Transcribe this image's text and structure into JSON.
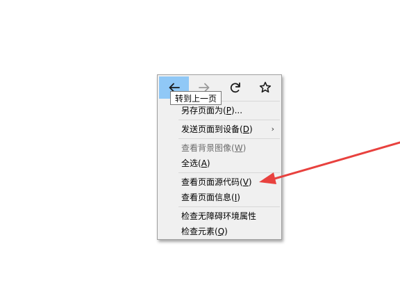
{
  "context_menu": {
    "nav": {
      "back_icon": "arrow-left-icon",
      "forward_icon": "arrow-right-icon",
      "reload_icon": "reload-icon",
      "bookmark_icon": "star-icon"
    },
    "tooltip": "转到上一页",
    "items": [
      {
        "label": "另存页面为(",
        "key": "P",
        "suffix": ")..."
      },
      {
        "label": "发送页面到设备(",
        "key": "D",
        "suffix": ")"
      },
      {
        "label": "查看背景图像(",
        "key": "W",
        "suffix": ")"
      },
      {
        "label": "全选(",
        "key": "A",
        "suffix": ")"
      },
      {
        "label": "查看页面源代码(",
        "key": "V",
        "suffix": ")"
      },
      {
        "label": "查看页面信息(",
        "key": "I",
        "suffix": ")"
      },
      {
        "label": "检查无障碍环境属性",
        "key": "",
        "suffix": ""
      },
      {
        "label": "检查元素(",
        "key": "Q",
        "suffix": ")"
      }
    ],
    "submenu_arrow": "›"
  },
  "colors": {
    "menu_bg": "#f0f0f0",
    "active_nav": "#90c8f6",
    "disabled_text": "#6d6d6d",
    "annotation_arrow": "#e8413e"
  }
}
